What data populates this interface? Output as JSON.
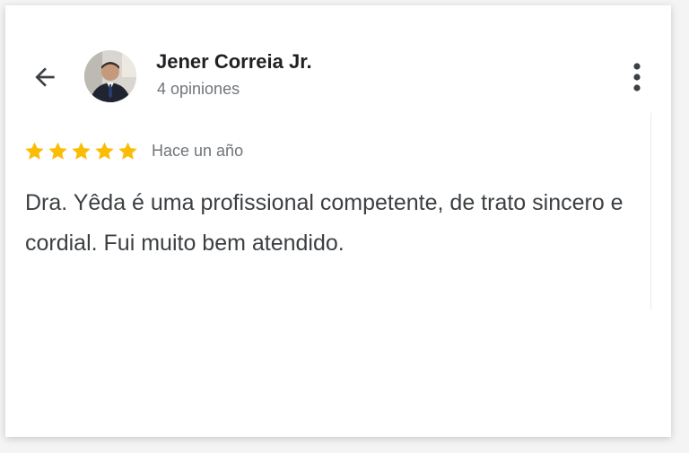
{
  "header": {
    "cut_text": "……… ………",
    "reviewer_name": "Jener Correia Jr.",
    "reviewer_review_count": "4 opiniones",
    "back_icon": "arrow-left-icon",
    "more_icon": "more-vertical-icon"
  },
  "review": {
    "rating": 5,
    "rating_max": 5,
    "date": "Hace un año",
    "text": "Dra. Yêda é uma profissional competente, de trato sincero e cordial. Fui muito bem atendido."
  },
  "colors": {
    "star": "#fbbc04",
    "name": "#202124",
    "secondary_text": "#70757a",
    "body_text": "#3c4043"
  }
}
